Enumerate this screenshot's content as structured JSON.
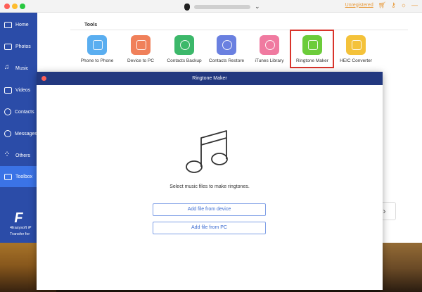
{
  "header": {
    "unregistered": "Unregistered",
    "icons": [
      "cart-icon",
      "key-icon",
      "lightbulb-icon",
      "minus-icon"
    ]
  },
  "sidebar": {
    "items": [
      {
        "label": "Home",
        "icon": "home-icon"
      },
      {
        "label": "Photos",
        "icon": "photos-icon"
      },
      {
        "label": "Music",
        "icon": "music-icon"
      },
      {
        "label": "Videos",
        "icon": "videos-icon"
      },
      {
        "label": "Contacts",
        "icon": "contacts-icon"
      },
      {
        "label": "Messages",
        "icon": "messages-icon"
      },
      {
        "label": "Others",
        "icon": "others-icon"
      },
      {
        "label": "Toolbox",
        "icon": "toolbox-icon"
      }
    ],
    "brand": {
      "logo": "F",
      "line1": "4Easysoft iP",
      "line2": "Transfer for"
    }
  },
  "tools": {
    "title": "Tools",
    "items": [
      {
        "label": "Phone to Phone",
        "color": "#5aaef0"
      },
      {
        "label": "Device to PC",
        "color": "#f0805a"
      },
      {
        "label": "Contacts Backup",
        "color": "#3cb86a"
      },
      {
        "label": "Contacts Restore",
        "color": "#6a80e0"
      },
      {
        "label": "iTunes Library",
        "color": "#f07aa0"
      },
      {
        "label": "Ringtone Maker",
        "color": "#6ccc3a"
      },
      {
        "label": "HEIC Converter",
        "color": "#f4c23a"
      }
    ],
    "next": "›"
  },
  "ringtone_maker": {
    "title": "Ringtone Maker",
    "prompt": "Select music files to make ringtones.",
    "add_device": "Add file from device",
    "add_pc": "Add file from PC"
  },
  "colors": {
    "sidebar": "#2b4ca8",
    "sidebar_active": "#3b73e6",
    "dialog_bar": "#22387f",
    "highlight": "#d9342b",
    "accent": "#e89a3a"
  }
}
